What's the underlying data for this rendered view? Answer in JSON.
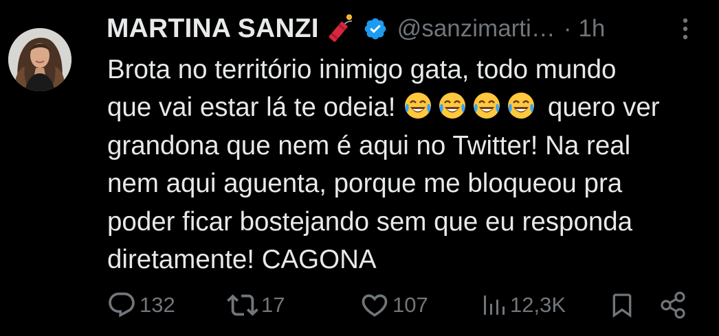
{
  "author": {
    "name": "MARTINA SANZI",
    "handle": "@sanzimarti…",
    "separator": "·",
    "time": "1h",
    "verified": true,
    "name_emoji": "firecracker-icon"
  },
  "tweet": {
    "lines": [
      "Brota no território inimigo gata, todo mundo",
      "que vai estar lá te odeia!",
      "quero ver",
      "grandona que nem é aqui no Twitter! Na real",
      "nem aqui aguenta, porque me bloqueou pra",
      "poder ficar bostejando sem que eu responda",
      "diretamente! CAGONA"
    ],
    "emojis": [
      "😂",
      "😂",
      "😂",
      "😂"
    ]
  },
  "actions": {
    "replies": "132",
    "retweets": "17",
    "likes": "107",
    "views": "12,3K"
  },
  "colors": {
    "background": "#000000",
    "text": "#e7e9ea",
    "muted": "#71767b",
    "verified": "#1d9bf0"
  }
}
